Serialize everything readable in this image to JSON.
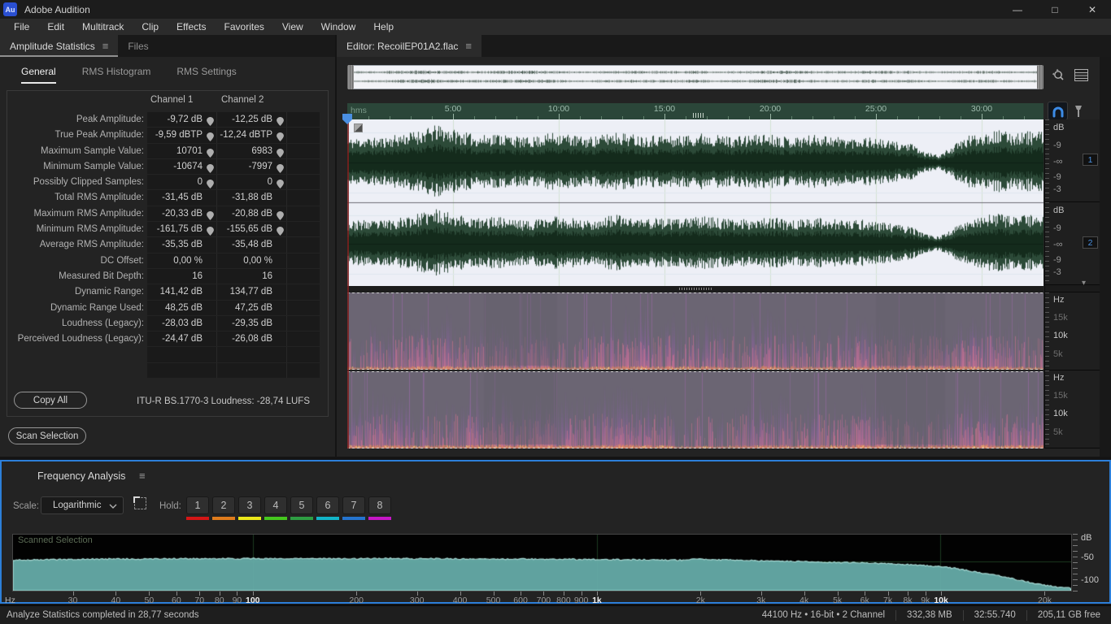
{
  "window": {
    "title": "Adobe Audition",
    "logo_text": "Au",
    "controls": {
      "minimize": "—",
      "maximize": "□",
      "close": "✕"
    }
  },
  "menubar": {
    "items": [
      "File",
      "Edit",
      "Multitrack",
      "Clip",
      "Effects",
      "Favorites",
      "View",
      "Window",
      "Help"
    ]
  },
  "stats_panel": {
    "tab_label": "Amplitude Statistics",
    "files_tab_label": "Files",
    "tabs": [
      "General",
      "RMS Histogram",
      "RMS Settings"
    ],
    "active_tab": "General",
    "columns": [
      "Channel 1",
      "Channel 2"
    ],
    "rows": [
      {
        "label": "Peak Amplitude:",
        "ch1": "-9,72 dB",
        "ch2": "-12,25 dB",
        "pin": true
      },
      {
        "label": "True Peak Amplitude:",
        "ch1": "-9,59 dBTP",
        "ch2": "-12,24 dBTP",
        "pin": true
      },
      {
        "label": "Maximum Sample Value:",
        "ch1": "10701",
        "ch2": "6983",
        "pin": true
      },
      {
        "label": "Minimum Sample Value:",
        "ch1": "-10674",
        "ch2": "-7997",
        "pin": true
      },
      {
        "label": "Possibly Clipped Samples:",
        "ch1": "0",
        "ch2": "0",
        "pin": true
      },
      {
        "label": "Total RMS Amplitude:",
        "ch1": "-31,45 dB",
        "ch2": "-31,88 dB",
        "pin": false
      },
      {
        "label": "Maximum RMS Amplitude:",
        "ch1": "-20,33 dB",
        "ch2": "-20,88 dB",
        "pin": true
      },
      {
        "label": "Minimum RMS Amplitude:",
        "ch1": "-161,75 dB",
        "ch2": "-155,65 dB",
        "pin": true
      },
      {
        "label": "Average RMS Amplitude:",
        "ch1": "-35,35 dB",
        "ch2": "-35,48 dB",
        "pin": false
      },
      {
        "label": "DC Offset:",
        "ch1": "0,00 %",
        "ch2": "0,00 %",
        "pin": false
      },
      {
        "label": "Measured Bit Depth:",
        "ch1": "16",
        "ch2": "16",
        "pin": false
      },
      {
        "label": "Dynamic Range:",
        "ch1": "141,42 dB",
        "ch2": "134,77 dB",
        "pin": false
      },
      {
        "label": "Dynamic Range Used:",
        "ch1": "48,25 dB",
        "ch2": "47,25 dB",
        "pin": false
      },
      {
        "label": "Loudness (Legacy):",
        "ch1": "-28,03 dB",
        "ch2": "-29,35 dB",
        "pin": false
      },
      {
        "label": "Perceived Loudness (Legacy):",
        "ch1": "-24,47 dB",
        "ch2": "-26,08 dB",
        "pin": false
      }
    ],
    "copy_all_label": "Copy All",
    "loudness_summary": "ITU-R BS.1770-3 Loudness:  -28,74 LUFS",
    "scan_selection_label": "Scan Selection"
  },
  "editor": {
    "tab_label": "Editor: RecoilEP01A2.flac",
    "timeline": {
      "unit": "hms",
      "ticks": [
        {
          "t": 5,
          "label": "5:00"
        },
        {
          "t": 10,
          "label": "10:00"
        },
        {
          "t": 15,
          "label": "15:00"
        },
        {
          "t": 20,
          "label": "20:00"
        },
        {
          "t": 25,
          "label": "25:00"
        },
        {
          "t": 30,
          "label": "30:00"
        }
      ]
    },
    "db_sections": [
      {
        "header": "dB",
        "labels": [
          "-9",
          "-∞",
          "-9",
          "-3"
        ],
        "badge": "1"
      },
      {
        "header": "dB",
        "labels": [
          "-9",
          "-∞",
          "-9",
          "-3"
        ],
        "badge": "2"
      }
    ],
    "hz_sections": [
      {
        "header": "Hz",
        "labels": [
          "15k",
          "10k",
          "5k"
        ]
      },
      {
        "header": "Hz",
        "labels": [
          "15k",
          "10k",
          "5k"
        ]
      }
    ],
    "waveform_envelope": [
      0.32,
      0.34,
      0.33,
      0.36,
      0.4,
      0.44,
      0.5,
      0.46,
      0.4,
      0.36,
      0.4,
      0.37,
      0.33,
      0.36,
      0.41,
      0.38,
      0.34,
      0.36,
      0.42,
      0.39,
      0.36,
      0.38,
      0.35,
      0.37,
      0.4,
      0.37,
      0.35,
      0.36,
      0.39,
      0.37,
      0.34,
      0.36,
      0.38,
      0.35,
      0.33,
      0.35,
      0.31,
      0.28,
      0.26,
      0.14,
      0.1,
      0.24,
      0.36,
      0.41,
      0.43,
      0.4,
      0.42,
      0.41
    ]
  },
  "freq_panel": {
    "title": "Frequency Analysis",
    "scale_label": "Scale:",
    "scale_value": "Logarithmic",
    "hold_label": "Hold:",
    "hold_buttons": [
      {
        "label": "1",
        "color": "#d41616"
      },
      {
        "label": "2",
        "color": "#e07c1c"
      },
      {
        "label": "3",
        "color": "#ece81a"
      },
      {
        "label": "4",
        "color": "#45c81e"
      },
      {
        "label": "5",
        "color": "#2e9e43"
      },
      {
        "label": "6",
        "color": "#12b5c9"
      },
      {
        "label": "7",
        "color": "#2574cf"
      },
      {
        "label": "8",
        "color": "#c717c7"
      }
    ],
    "plot_label": "Scanned Selection"
  },
  "chart_data": {
    "type": "area",
    "title": "Frequency Analysis — Scanned Selection",
    "xlabel": "Hz",
    "ylabel": "dB",
    "x_scale": "log",
    "xlim": [
      20,
      24000
    ],
    "ylim": [
      -105,
      0
    ],
    "grid": "decade verticals at 100/1k/10k and horizontal at -50",
    "y_ticks": [
      {
        "label": "dB",
        "y": 0
      },
      {
        "label": "-50",
        "y": -50
      },
      {
        "label": "-100",
        "y": -100
      }
    ],
    "x_ticks": [
      {
        "f": 30,
        "l": "30"
      },
      {
        "f": 40,
        "l": "40"
      },
      {
        "f": 50,
        "l": "50"
      },
      {
        "f": 60,
        "l": "60"
      },
      {
        "f": 70,
        "l": "70"
      },
      {
        "f": 80,
        "l": "80"
      },
      {
        "f": 90,
        "l": "90"
      },
      {
        "f": 100,
        "l": "100",
        "strong": true
      },
      {
        "f": 200,
        "l": "200"
      },
      {
        "f": 300,
        "l": "300"
      },
      {
        "f": 400,
        "l": "400"
      },
      {
        "f": 500,
        "l": "500"
      },
      {
        "f": 600,
        "l": "600"
      },
      {
        "f": 700,
        "l": "700"
      },
      {
        "f": 800,
        "l": "800"
      },
      {
        "f": 900,
        "l": "900"
      },
      {
        "f": 1000,
        "l": "1k",
        "strong": true
      },
      {
        "f": 2000,
        "l": "2k"
      },
      {
        "f": 3000,
        "l": "3k"
      },
      {
        "f": 4000,
        "l": "4k"
      },
      {
        "f": 5000,
        "l": "5k"
      },
      {
        "f": 6000,
        "l": "6k"
      },
      {
        "f": 7000,
        "l": "7k"
      },
      {
        "f": 8000,
        "l": "8k"
      },
      {
        "f": 9000,
        "l": "9k"
      },
      {
        "f": 10000,
        "l": "10k",
        "strong": true
      },
      {
        "f": 20000,
        "l": "20k"
      }
    ],
    "series": [
      {
        "name": "Scanned Selection",
        "fill_color": "#68b0ac",
        "line_color": "#a9dcd6",
        "points": [
          [
            20,
            -48
          ],
          [
            25,
            -47
          ],
          [
            30,
            -46.3
          ],
          [
            40,
            -45.6
          ],
          [
            50,
            -45.8
          ],
          [
            60,
            -45.1
          ],
          [
            70,
            -45.4
          ],
          [
            80,
            -45.0
          ],
          [
            90,
            -45.3
          ],
          [
            100,
            -44.7
          ],
          [
            120,
            -45.2
          ],
          [
            150,
            -44.9
          ],
          [
            180,
            -45.4
          ],
          [
            200,
            -45.1
          ],
          [
            250,
            -44.6
          ],
          [
            300,
            -45.3
          ],
          [
            350,
            -44.9
          ],
          [
            400,
            -45.6
          ],
          [
            500,
            -46.0
          ],
          [
            600,
            -45.8
          ],
          [
            700,
            -46.3
          ],
          [
            800,
            -46.1
          ],
          [
            900,
            -46.6
          ],
          [
            1000,
            -46.4
          ],
          [
            1200,
            -46.9
          ],
          [
            1500,
            -47.4
          ],
          [
            1800,
            -47.8
          ],
          [
            2000,
            -45.6
          ],
          [
            2300,
            -47.2
          ],
          [
            2600,
            -48.0
          ],
          [
            3000,
            -48.8
          ],
          [
            3500,
            -49.8
          ],
          [
            4000,
            -50.4
          ],
          [
            4500,
            -51.2
          ],
          [
            5000,
            -52.0
          ],
          [
            6000,
            -53.2
          ],
          [
            7000,
            -54.6
          ],
          [
            8000,
            -56.2
          ],
          [
            9000,
            -58.0
          ],
          [
            10000,
            -60.0
          ],
          [
            11000,
            -63.0
          ],
          [
            12000,
            -67.5
          ],
          [
            14000,
            -74.5
          ],
          [
            16000,
            -81.5
          ],
          [
            18000,
            -89.0
          ],
          [
            20000,
            -95.0
          ],
          [
            23000,
            -100.0
          ]
        ]
      }
    ]
  },
  "statusbar": {
    "left": "Analyze Statistics completed in 28,77 seconds",
    "format": "44100 Hz • 16-bit • 2 Channel",
    "size": "332,38 MB",
    "time": "32:55.740",
    "free": "205,11 GB free"
  }
}
